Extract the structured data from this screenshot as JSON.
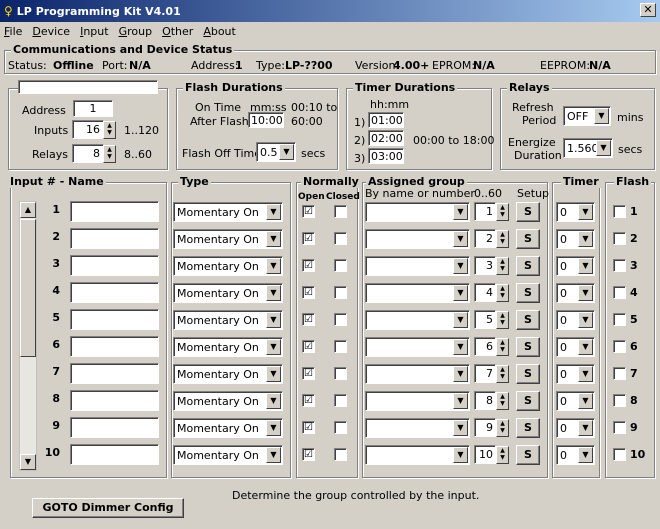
{
  "window": {
    "title": "LP Programming Kit V4.01"
  },
  "menu": [
    {
      "text": "File",
      "key": "F",
      "rest": "ile"
    },
    {
      "text": "Device",
      "key": "D",
      "rest": "evice"
    },
    {
      "text": "Input",
      "key": "I",
      "rest": "nput"
    },
    {
      "text": "Group",
      "key": "G",
      "rest": "roup"
    },
    {
      "text": "Other",
      "key": "O",
      "rest": "ther"
    },
    {
      "text": "About",
      "key": "A",
      "rest": "bout"
    }
  ],
  "status": {
    "title": "Communications and Device Status",
    "status_label": "Status:",
    "status_value": "Offline",
    "port_label": "Port:",
    "port_value": "N/A",
    "address_label": "Address:",
    "address_value": "1",
    "type_label": "Type:",
    "type_value": "LP-??00",
    "version_label": "Version:",
    "version_value": "4.00+",
    "eprom1_label": "EPROM:",
    "eprom1_value": "N/A",
    "eprom2_label": "EEPROM:",
    "eprom2_value": "N/A"
  },
  "device": {
    "name_value": "",
    "address_label": "Address",
    "address_value": "1",
    "inputs_label": "Inputs",
    "inputs_value": "16",
    "inputs_range": "1..120",
    "relays_label": "Relays",
    "relays_value": "8",
    "relays_range": "8..60"
  },
  "flash": {
    "title": "Flash Durations",
    "on_time_label": "On Time",
    "units": "mm:ss",
    "on_range": "00:10 to",
    "after_label": "After Flash",
    "after_value": "10:00",
    "after_range": "60:00",
    "off_label": "Flash Off Time",
    "off_value": "0.5",
    "off_units": "secs"
  },
  "timer": {
    "title": "Timer Durations",
    "units": "hh:mm",
    "t1_label": "1)",
    "t1": "01:00",
    "t2_label": "2)",
    "t2": "02:00",
    "t3_label": "3)",
    "t3": "03:00",
    "range": "00:00 to 18:00"
  },
  "relays": {
    "title": "Relays",
    "refresh_label1": "Refresh",
    "refresh_label2": "Period",
    "refresh_value": "OFF",
    "refresh_units": "mins",
    "energize_label1": "Energize",
    "energize_label2": "Duration",
    "energize_value": "1.560",
    "energize_units": "secs"
  },
  "headers": {
    "input": "Input # - Name",
    "type": "Type",
    "normally": "Normally",
    "open": "Open",
    "closed": "Closed",
    "assigned": "Assigned group",
    "by_name": "By name or number",
    "range": "0..60",
    "setup": "Setup",
    "timer": "Timer",
    "flash": "Flash"
  },
  "rows": [
    {
      "num": "1",
      "name": "",
      "type": "Momentary On",
      "open": "☑",
      "closed": "",
      "group": "",
      "gnum": "1",
      "setup": "S",
      "timer": "0",
      "flash": "",
      "flash_num": "1"
    },
    {
      "num": "2",
      "name": "",
      "type": "Momentary On",
      "open": "☑",
      "closed": "",
      "group": "",
      "gnum": "2",
      "setup": "S",
      "timer": "0",
      "flash": "",
      "flash_num": "2"
    },
    {
      "num": "3",
      "name": "",
      "type": "Momentary On",
      "open": "☑",
      "closed": "",
      "group": "",
      "gnum": "3",
      "setup": "S",
      "timer": "0",
      "flash": "",
      "flash_num": "3"
    },
    {
      "num": "4",
      "name": "",
      "type": "Momentary On",
      "open": "☑",
      "closed": "",
      "group": "",
      "gnum": "4",
      "setup": "S",
      "timer": "0",
      "flash": "",
      "flash_num": "4"
    },
    {
      "num": "5",
      "name": "",
      "type": "Momentary On",
      "open": "☑",
      "closed": "",
      "group": "",
      "gnum": "5",
      "setup": "S",
      "timer": "0",
      "flash": "",
      "flash_num": "5"
    },
    {
      "num": "6",
      "name": "",
      "type": "Momentary On",
      "open": "☑",
      "closed": "",
      "group": "",
      "gnum": "6",
      "setup": "S",
      "timer": "0",
      "flash": "",
      "flash_num": "6"
    },
    {
      "num": "7",
      "name": "",
      "type": "Momentary On",
      "open": "☑",
      "closed": "",
      "group": "",
      "gnum": "7",
      "setup": "S",
      "timer": "0",
      "flash": "",
      "flash_num": "7"
    },
    {
      "num": "8",
      "name": "",
      "type": "Momentary On",
      "open": "☑",
      "closed": "",
      "group": "",
      "gnum": "8",
      "setup": "S",
      "timer": "0",
      "flash": "",
      "flash_num": "8"
    },
    {
      "num": "9",
      "name": "",
      "type": "Momentary On",
      "open": "☑",
      "closed": "",
      "group": "",
      "gnum": "9",
      "setup": "S",
      "timer": "0",
      "flash": "",
      "flash_num": "9"
    },
    {
      "num": "10",
      "name": "",
      "type": "Momentary On",
      "open": "☑",
      "closed": "",
      "group": "",
      "gnum": "10",
      "setup": "S",
      "timer": "0",
      "flash": "",
      "flash_num": "10"
    }
  ],
  "footer": {
    "hint": "Determine the group controlled by the input.",
    "goto": "GOTO Dimmer Config"
  }
}
